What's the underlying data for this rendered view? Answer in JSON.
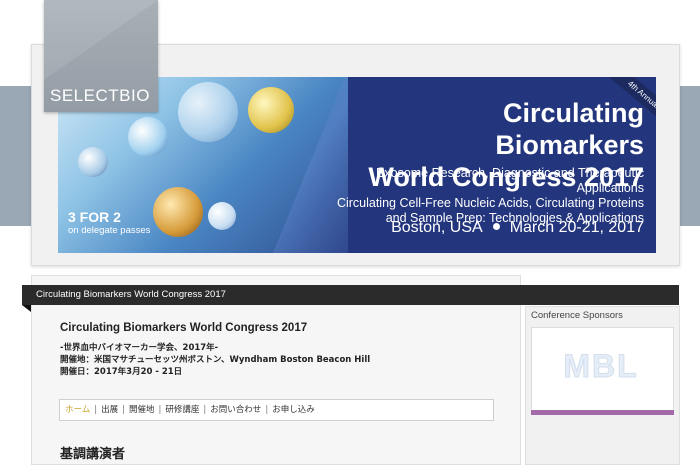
{
  "brand": {
    "logo_text_a": "SELECT",
    "logo_text_b": "BIO"
  },
  "banner": {
    "annual_label": "4th Annual",
    "title_line1": "Circulating Biomarkers",
    "title_line2": "World Congress 2017",
    "subtitle_line1": "Exosome Research, Diagnostic and Therapeutic Applications",
    "subtitle_line2": "Circulating Cell-Free Nucleic Acids, Circulating Proteins",
    "subtitle_line3": "and Sample Prep: Technologies & Applications",
    "location": "Boston, USA",
    "dates": "March 20-21, 2017",
    "promo_big": "3 FOR 2",
    "promo_small": "on delegate passes"
  },
  "breadcrumb_bar": {
    "text": "Circulating Biomarkers World Congress 2017"
  },
  "event": {
    "title": "Circulating Biomarkers World Congress 2017",
    "jp_name": "-世界血中バイオマーカー学会、2017年-",
    "venue": "開催地：米国マサチューセッツ州ボストン、Wyndham Boston Beacon Hill",
    "date": "開催日：2017年3月20 - 21日"
  },
  "nav": {
    "items": [
      {
        "label": "ホーム",
        "active": true
      },
      {
        "label": "出展",
        "active": false
      },
      {
        "label": "開催地",
        "active": false
      },
      {
        "label": "研修講座",
        "active": false
      },
      {
        "label": "お問い合わせ",
        "active": false
      },
      {
        "label": "お申し込み",
        "active": false
      }
    ]
  },
  "section": {
    "keynote_heading": "基調講演者"
  },
  "sidebar": {
    "title": "Conference Sponsors",
    "sponsor_logo_text": "MBL"
  },
  "colors": {
    "banner_navy": "#23357c",
    "nav_active": "#c8a02a",
    "dark_bar": "#2b2b2b",
    "sponsor_accent": "#a46aa9"
  }
}
